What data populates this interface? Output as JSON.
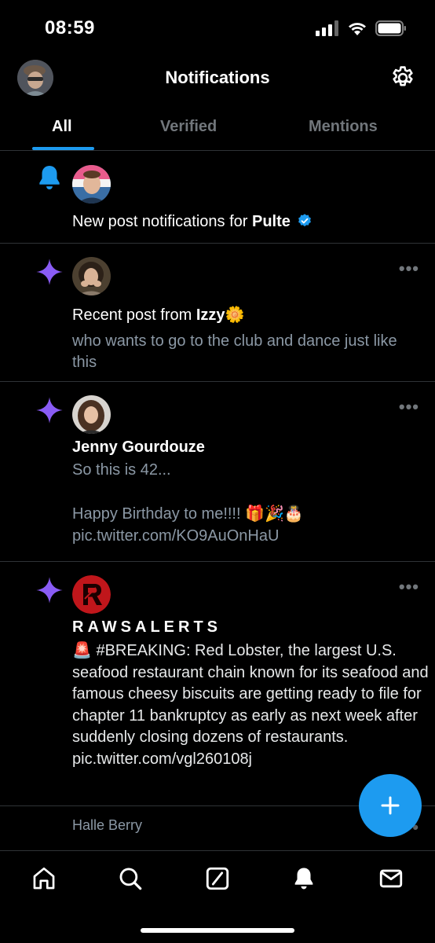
{
  "status_bar": {
    "time": "08:59"
  },
  "header": {
    "title": "Notifications"
  },
  "tabs": [
    {
      "label": "All",
      "active": true
    },
    {
      "label": "Verified",
      "active": false
    },
    {
      "label": "Mentions",
      "active": false
    }
  ],
  "notifications": [
    {
      "type": "bell",
      "text_prefix": "New post notifications for ",
      "account": "Pulte",
      "verified": true
    },
    {
      "type": "sparkle",
      "text_prefix": "Recent post from ",
      "account": "Izzy",
      "account_emoji": "🌼",
      "preview": "who wants to go to the club and dance just like this",
      "more": "•••"
    },
    {
      "type": "sparkle",
      "author": "Jenny Gourdouze",
      "line1": "So this is 42...",
      "line2": "Happy Birthday to me!!!! 🎁🎉🎂",
      "line3": "pic.twitter.com/KO9AuOnHaU",
      "more": "•••"
    },
    {
      "type": "sparkle",
      "author": "RAWSALERTS",
      "body": "🚨 #BREAKING: Red Lobster, the largest U.S. seafood restaurant chain known for its seafood and famous cheesy biscuits are getting ready to file for chapter 11 bankruptcy as early as next week after suddenly closing dozens of restaurants. pic.twitter.com/vgl260108j",
      "more": "•••"
    },
    {
      "type": "bell",
      "label": "Halle Berry",
      "more": "•••"
    }
  ],
  "fab": {
    "label": "+"
  },
  "bottom_nav": [
    {
      "icon": "home-icon"
    },
    {
      "icon": "search-icon"
    },
    {
      "icon": "grok-icon"
    },
    {
      "icon": "bell-icon",
      "active": true
    },
    {
      "icon": "mail-icon"
    }
  ],
  "colors": {
    "accent": "#1d9bf0",
    "sparkle": "#8a5cf5",
    "background": "#000000",
    "muted": "#71767b"
  }
}
